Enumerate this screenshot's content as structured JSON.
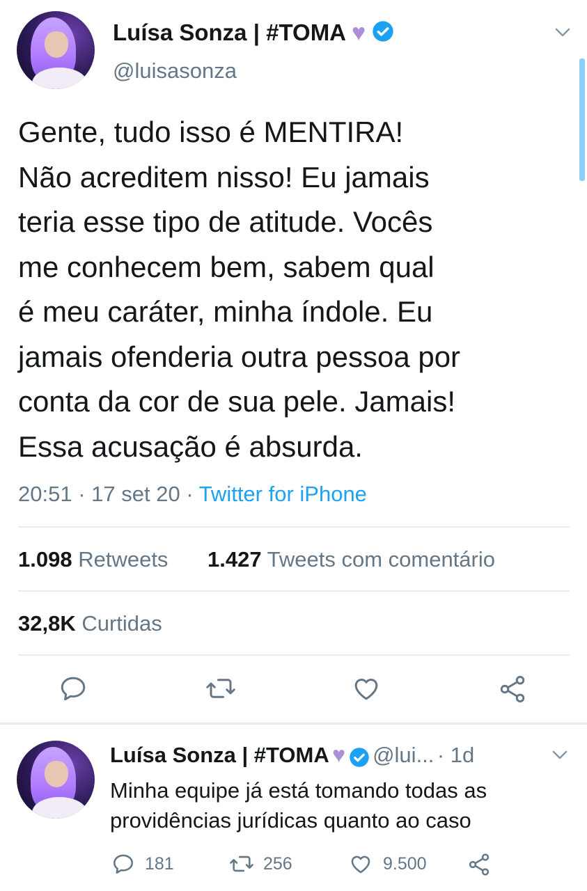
{
  "tweet": {
    "author_name": "Luísa Sonza | #TOMA",
    "author_handle": "@luisasonza",
    "text": "Gente, tudo isso é MENTIRA!\nNão acreditem nisso! Eu jamais\nteria esse tipo de atitude. Vocês\nme conhecem bem, sabem qual\né meu caráter, minha índole. Eu\njamais ofenderia outra pessoa por\nconta da cor de sua pele. Jamais!\nEssa acusação é absurda.",
    "time": "20:51",
    "date": "17 set 20",
    "source": "Twitter for iPhone",
    "retweets_count": "1.098",
    "retweets_label": "Retweets",
    "quotes_count": "1.427",
    "quotes_label": "Tweets com comentário",
    "likes_count": "32,8K",
    "likes_label": "Curtidas"
  },
  "reply": {
    "author_name": "Luísa Sonza | #TOMA",
    "author_handle": "@lui...",
    "age": "1d",
    "text": "Minha equipe já está tomando todas as providências jurídicas quanto ao caso",
    "replies": "181",
    "retweets": "256",
    "likes": "9.500"
  },
  "icons": {
    "heart": "purple-heart-emoji",
    "verified": "verified-badge-icon",
    "more": "chevron-down-icon"
  },
  "colors": {
    "accent": "#1da1f2",
    "secondary_text": "#657786",
    "heart": "#ac8ed7"
  }
}
